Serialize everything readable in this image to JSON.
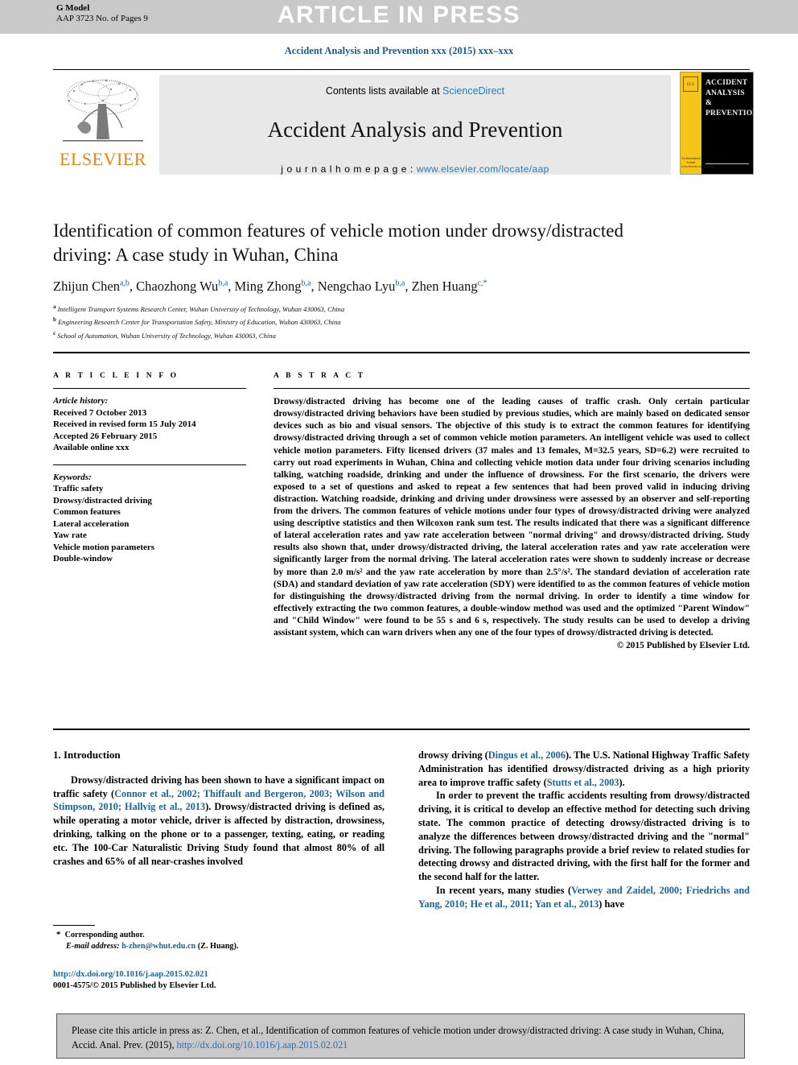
{
  "banner": {
    "text": "ARTICLE IN PRESS",
    "g_model_line1": "G Model",
    "g_model_line2": "AAP 3723 No. of Pages 9"
  },
  "journal_line": "Accident Analysis and Prevention xxx (2015) xxx–xxx",
  "masthead": {
    "contents_prefix": "Contents lists available at ",
    "contents_link": "ScienceDirect",
    "journal_title": "Accident Analysis and Prevention",
    "homepage_label": "j o u r n a l   h o m e p a g e :  ",
    "homepage_url": "www.elsevier.com/locate/aap",
    "elsevier_wordmark": "ELSEVIER",
    "cover_title": "ACCIDENT ANALYSIS & PREVENTION",
    "cover_logo_text": "ELS",
    "cover_foot_text": "An International Journal www.elsevier.com/locate/aap"
  },
  "article": {
    "title": "Identification of common features of vehicle motion under drowsy/distracted driving: A case study in Wuhan, China",
    "authors_plain": "Zhijun Chen a,b, Chaozhong Wu b,a, Ming Zhong b,a, Nengchao Lyu b,a, Zhen Huang c,*",
    "affiliations": [
      {
        "mark": "a",
        "text": "Intelligent Transport Systems Research Center, Wuhan University of Technology, Wuhan 430063, China"
      },
      {
        "mark": "b",
        "text": "Engineering Research Center for Transportation Safety, Ministry of Education, Wuhan 430063, China"
      },
      {
        "mark": "c",
        "text": "School of Automation, Wuhan University of Technology, Wuhan 430063, China"
      }
    ]
  },
  "article_info": {
    "heading": "A R T I C L E   I N F O",
    "history_label": "Article history:",
    "history": [
      "Received 7 October 2013",
      "Received in revised form 15 July 2014",
      "Accepted 26 February 2015",
      "Available online xxx"
    ],
    "keywords_label": "Keywords:",
    "keywords": [
      "Traffic safety",
      "Drowsy/distracted driving",
      "Common features",
      "Lateral acceleration",
      "Yaw rate",
      "Vehicle motion parameters",
      "Double-window"
    ]
  },
  "abstract": {
    "heading": "A B S T R A C T",
    "text": "Drowsy/distracted driving has become one of the leading causes of traffic crash. Only certain particular drowsy/distracted driving behaviors have been studied by previous studies, which are mainly based on dedicated sensor devices such as bio and visual sensors. The objective of this study is to extract the common features for identifying drowsy/distracted driving through a set of common vehicle motion parameters. An intelligent vehicle was used to collect vehicle motion parameters. Fifty licensed drivers (37 males and 13 females, M=32.5 years, SD=6.2) were recruited to carry out road experiments in Wuhan, China and collecting vehicle motion data under four driving scenarios including talking, watching roadside, drinking and under the influence of drowsiness. For the first scenario, the drivers were exposed to a set of questions and asked to repeat a few sentences that had been proved valid in inducing driving distraction. Watching roadside, drinking and driving under drowsiness were assessed by an observer and self-reporting from the drivers. The common features of vehicle motions under four types of drowsy/distracted driving were analyzed using descriptive statistics and then Wilcoxon rank sum test. The results indicated that there was a significant difference of lateral acceleration rates and yaw rate acceleration between \"normal driving\" and drowsy/distracted driving. Study results also shown that, under drowsy/distracted driving, the lateral acceleration rates and yaw rate acceleration were significantly larger from the normal driving. The lateral acceleration rates were shown to suddenly increase or decrease by more than 2.0 m/s² and the yaw rate acceleration by more than 2.5°/s². The standard deviation of acceleration rate (SDA) and standard deviation of yaw rate acceleration (SDY) were identified to as the common features of vehicle motion for distinguishing the drowsy/distracted driving from the normal driving. In order to identify a time window for effectively extracting the two common features, a double-window method was used and the optimized \"Parent Window\" and \"Child Window\" were found to be 55 s and 6 s, respectively. The study results can be used to develop a driving assistant system, which can warn drivers when any one of the four types of drowsy/distracted driving is detected.",
    "copyright": "© 2015 Published by Elsevier Ltd."
  },
  "body": {
    "section_heading": "1. Introduction",
    "left_para1_a": "Drowsy/distracted driving has been shown to have a significant impact on traffic safety (",
    "left_para1_cite": "Connor et al., 2002; Thiffault and Bergeron, 2003; Wilson and Stimpson, 2010; Hallvig et al., 2013",
    "left_para1_b": "). Drowsy/distracted driving is defined as, while operating a motor vehicle, driver is affected by distraction, drowsiness, drinking, talking on the phone or to a passenger, texting, eating, or reading etc. The 100-Car Naturalistic Driving Study found that almost 80% of all crashes and 65% of all near-crashes involved",
    "right_para1_a": "drowsy driving (",
    "right_para1_cite1": "Dingus et al., 2006",
    "right_para1_b": "). The U.S. National Highway Traffic Safety Administration has identified drowsy/distracted driving as a high priority area to improve traffic safety (",
    "right_para1_cite2": "Stutts et al., 2003",
    "right_para1_c": ").",
    "right_para2": "In order to prevent the traffic accidents resulting from drowsy/distracted driving, it is critical to develop an effective method for detecting such driving state. The common practice of detecting drowsy/distracted driving is to analyze the differences between drowsy/distracted driving and the \"normal\" driving. The following paragraphs provide a brief review to related studies for detecting drowsy and distracted driving, with the first half for the former and the second half for the latter.",
    "right_para3_a": "In recent years, many studies (",
    "right_para3_cite": "Verwey and Zaidel, 2000; Friedrichs and Yang, 2010; He et al., 2011; Yan et al., 2013",
    "right_para3_b": ") have"
  },
  "footnote": {
    "corresponding": "Corresponding author.",
    "email_label": "E-mail address:",
    "email": "h-zhen@whut.edu.cn",
    "email_owner": "(Z. Huang).",
    "doi_url": "http://dx.doi.org/10.1016/j.aap.2015.02.021",
    "issn_line": "0001-4575/© 2015 Published by Elsevier Ltd."
  },
  "cite_box": {
    "text_a": "Please cite this article in press as: Z. Chen, et al., Identification of common features of vehicle motion under drowsy/distracted driving: A case study in Wuhan, China, Accid. Anal. Prev. (2015), ",
    "link": "http://dx.doi.org/10.1016/j.aap.2015.02.021"
  },
  "colors": {
    "link_blue": "#1a6496",
    "banner_grey": "#c9c9c9",
    "elsevier_orange": "#ee8013",
    "cover_yellow": "#f5c518"
  }
}
